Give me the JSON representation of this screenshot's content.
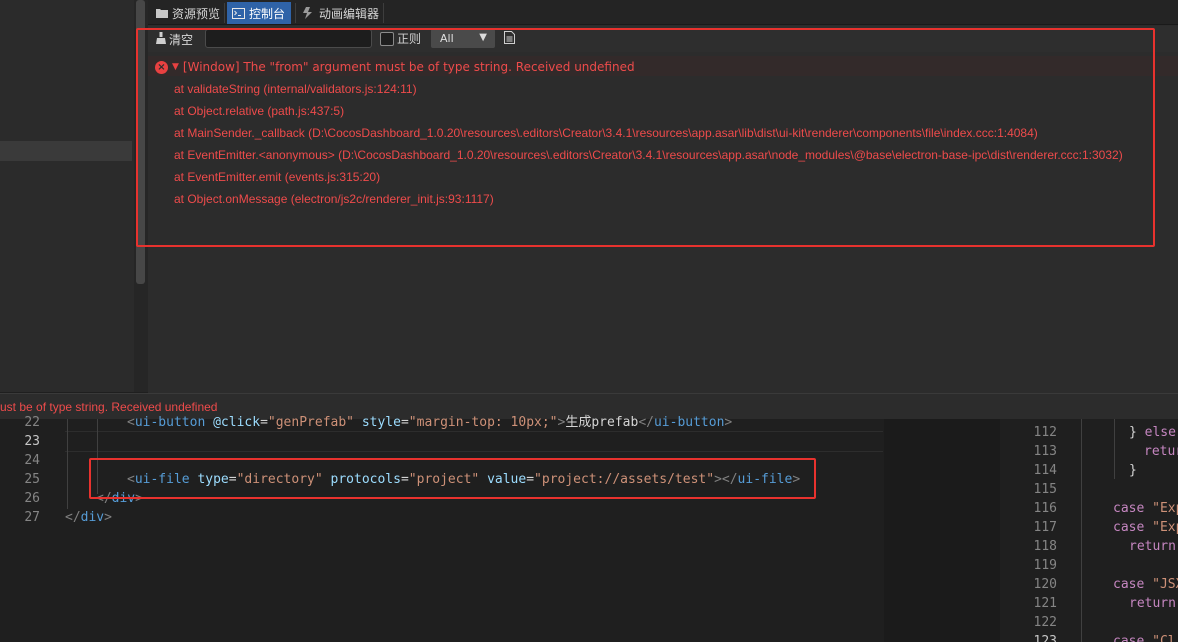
{
  "tabs": [
    {
      "label": "资源预览",
      "icon": "folder-icon",
      "active": false
    },
    {
      "label": "控制台",
      "icon": "terminal-icon",
      "active": true
    },
    {
      "label": "动画编辑器",
      "icon": "animation-icon",
      "active": false
    }
  ],
  "toolbar": {
    "clear_label": "清空",
    "search_value": "",
    "regex_label": "正则",
    "level_value": "All"
  },
  "log": {
    "error_message": "[Window] The \"from\" argument must be of type string. Received undefined",
    "stack": [
      "at validateString (internal/validators.js:124:11)",
      "at Object.relative (path.js:437:5)",
      "at MainSender._callback (D:\\CocosDashboard_1.0.20\\resources\\.editors\\Creator\\3.4.1\\resources\\app.asar\\lib\\dist\\ui-kit\\renderer\\components\\file\\index.ccc:1:4084)",
      "at EventEmitter.<anonymous> (D:\\CocosDashboard_1.0.20\\resources\\.editors\\Creator\\3.4.1\\resources\\app.asar\\node_modules\\@base\\electron-base-ipc\\dist\\renderer.ccc:1:3032)",
      "at EventEmitter.emit (events.js:315:20)",
      "at Object.onMessage (electron/js2c/renderer_init.js:93:1117)"
    ]
  },
  "status_bar": {
    "text": "ust be of type string. Received undefined"
  },
  "editor_left": {
    "lines": [
      {
        "num": "22",
        "tokens": [
          [
            "tag",
            "<"
          ],
          [
            "tname",
            "ui-button"
          ],
          [
            "txt",
            " "
          ],
          [
            "attr",
            "@click"
          ],
          [
            "txt",
            "="
          ],
          [
            "str",
            "\"genPrefab\""
          ],
          [
            "txt",
            " "
          ],
          [
            "attr",
            "style"
          ],
          [
            "txt",
            "="
          ],
          [
            "str",
            "\"margin-top: 10px;\""
          ],
          [
            "tag",
            ">"
          ],
          [
            "txt",
            "生成prefab"
          ],
          [
            "tag",
            "</"
          ],
          [
            "tname",
            "ui-button"
          ],
          [
            "tag",
            ">"
          ]
        ]
      },
      {
        "num": "23",
        "tokens": []
      },
      {
        "num": "24",
        "tokens": []
      },
      {
        "num": "25",
        "tokens": [
          [
            "tag",
            "<"
          ],
          [
            "tname",
            "ui-file"
          ],
          [
            "txt",
            " "
          ],
          [
            "attr",
            "type"
          ],
          [
            "txt",
            "="
          ],
          [
            "str",
            "\"directory\""
          ],
          [
            "txt",
            " "
          ],
          [
            "attr",
            "protocols"
          ],
          [
            "txt",
            "="
          ],
          [
            "str",
            "\"project\""
          ],
          [
            "txt",
            " "
          ],
          [
            "attr",
            "value"
          ],
          [
            "txt",
            "="
          ],
          [
            "str",
            "\"project://assets/test\""
          ],
          [
            "tag",
            "></"
          ],
          [
            "tname",
            "ui-file"
          ],
          [
            "tag",
            ">"
          ]
        ]
      },
      {
        "num": "26",
        "tokens": [
          [
            "tag",
            "</"
          ],
          [
            "tname",
            "div"
          ],
          [
            "tag",
            ">"
          ]
        ]
      },
      {
        "num": "27",
        "tokens": [
          [
            "tag",
            "</"
          ],
          [
            "tname",
            "div"
          ],
          [
            "tag",
            ">"
          ]
        ]
      }
    ]
  },
  "editor_right": {
    "lines": [
      {
        "num": "112",
        "tokens": [
          [
            "txt",
            "} "
          ],
          [
            "kw",
            "else"
          ]
        ]
      },
      {
        "num": "113",
        "tokens": [
          [
            "kw",
            "retur"
          ]
        ]
      },
      {
        "num": "114",
        "tokens": [
          [
            "txt",
            "}"
          ]
        ]
      },
      {
        "num": "115",
        "tokens": []
      },
      {
        "num": "116",
        "tokens": [
          [
            "kw",
            "case"
          ],
          [
            "txt",
            " "
          ],
          [
            "str",
            "\"Exp"
          ]
        ]
      },
      {
        "num": "117",
        "tokens": [
          [
            "kw",
            "case"
          ],
          [
            "txt",
            " "
          ],
          [
            "str",
            "\"Exp"
          ]
        ]
      },
      {
        "num": "118",
        "tokens": [
          [
            "kw",
            "return"
          ]
        ]
      },
      {
        "num": "119",
        "tokens": []
      },
      {
        "num": "120",
        "tokens": [
          [
            "kw",
            "case"
          ],
          [
            "txt",
            " "
          ],
          [
            "str",
            "\"JSX"
          ]
        ]
      },
      {
        "num": "121",
        "tokens": [
          [
            "kw",
            "return"
          ]
        ]
      },
      {
        "num": "122",
        "tokens": []
      },
      {
        "num": "123",
        "tokens": [
          [
            "kw",
            "case"
          ],
          [
            "txt",
            " "
          ],
          [
            "str",
            "\"Cl"
          ]
        ]
      }
    ]
  },
  "colors": {
    "error_red": "#ee4b4b",
    "annotation_red": "#e8322e",
    "active_tab": "#2f63a8"
  }
}
